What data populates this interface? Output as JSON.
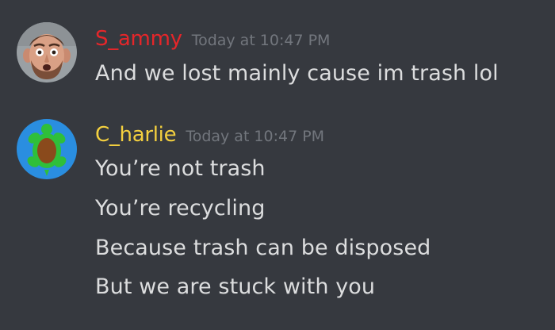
{
  "colors": {
    "background": "#36393f",
    "sammy": "#e5262a",
    "charlie": "#f4d03f",
    "timestamp": "#72767d",
    "text": "#dcddde"
  },
  "messages": [
    {
      "username": "S_ammy",
      "timestamp": "Today at 10:47 PM",
      "avatar_icon": "man-face-avatar",
      "lines": [
        "And we lost mainly cause im trash lol"
      ]
    },
    {
      "username": "C_harlie",
      "timestamp": "Today at 10:47 PM",
      "avatar_icon": "turtle-avatar",
      "lines": [
        "You’re not trash",
        "You’re recycling",
        "Because trash can be disposed",
        "But we are stuck with you"
      ]
    }
  ]
}
